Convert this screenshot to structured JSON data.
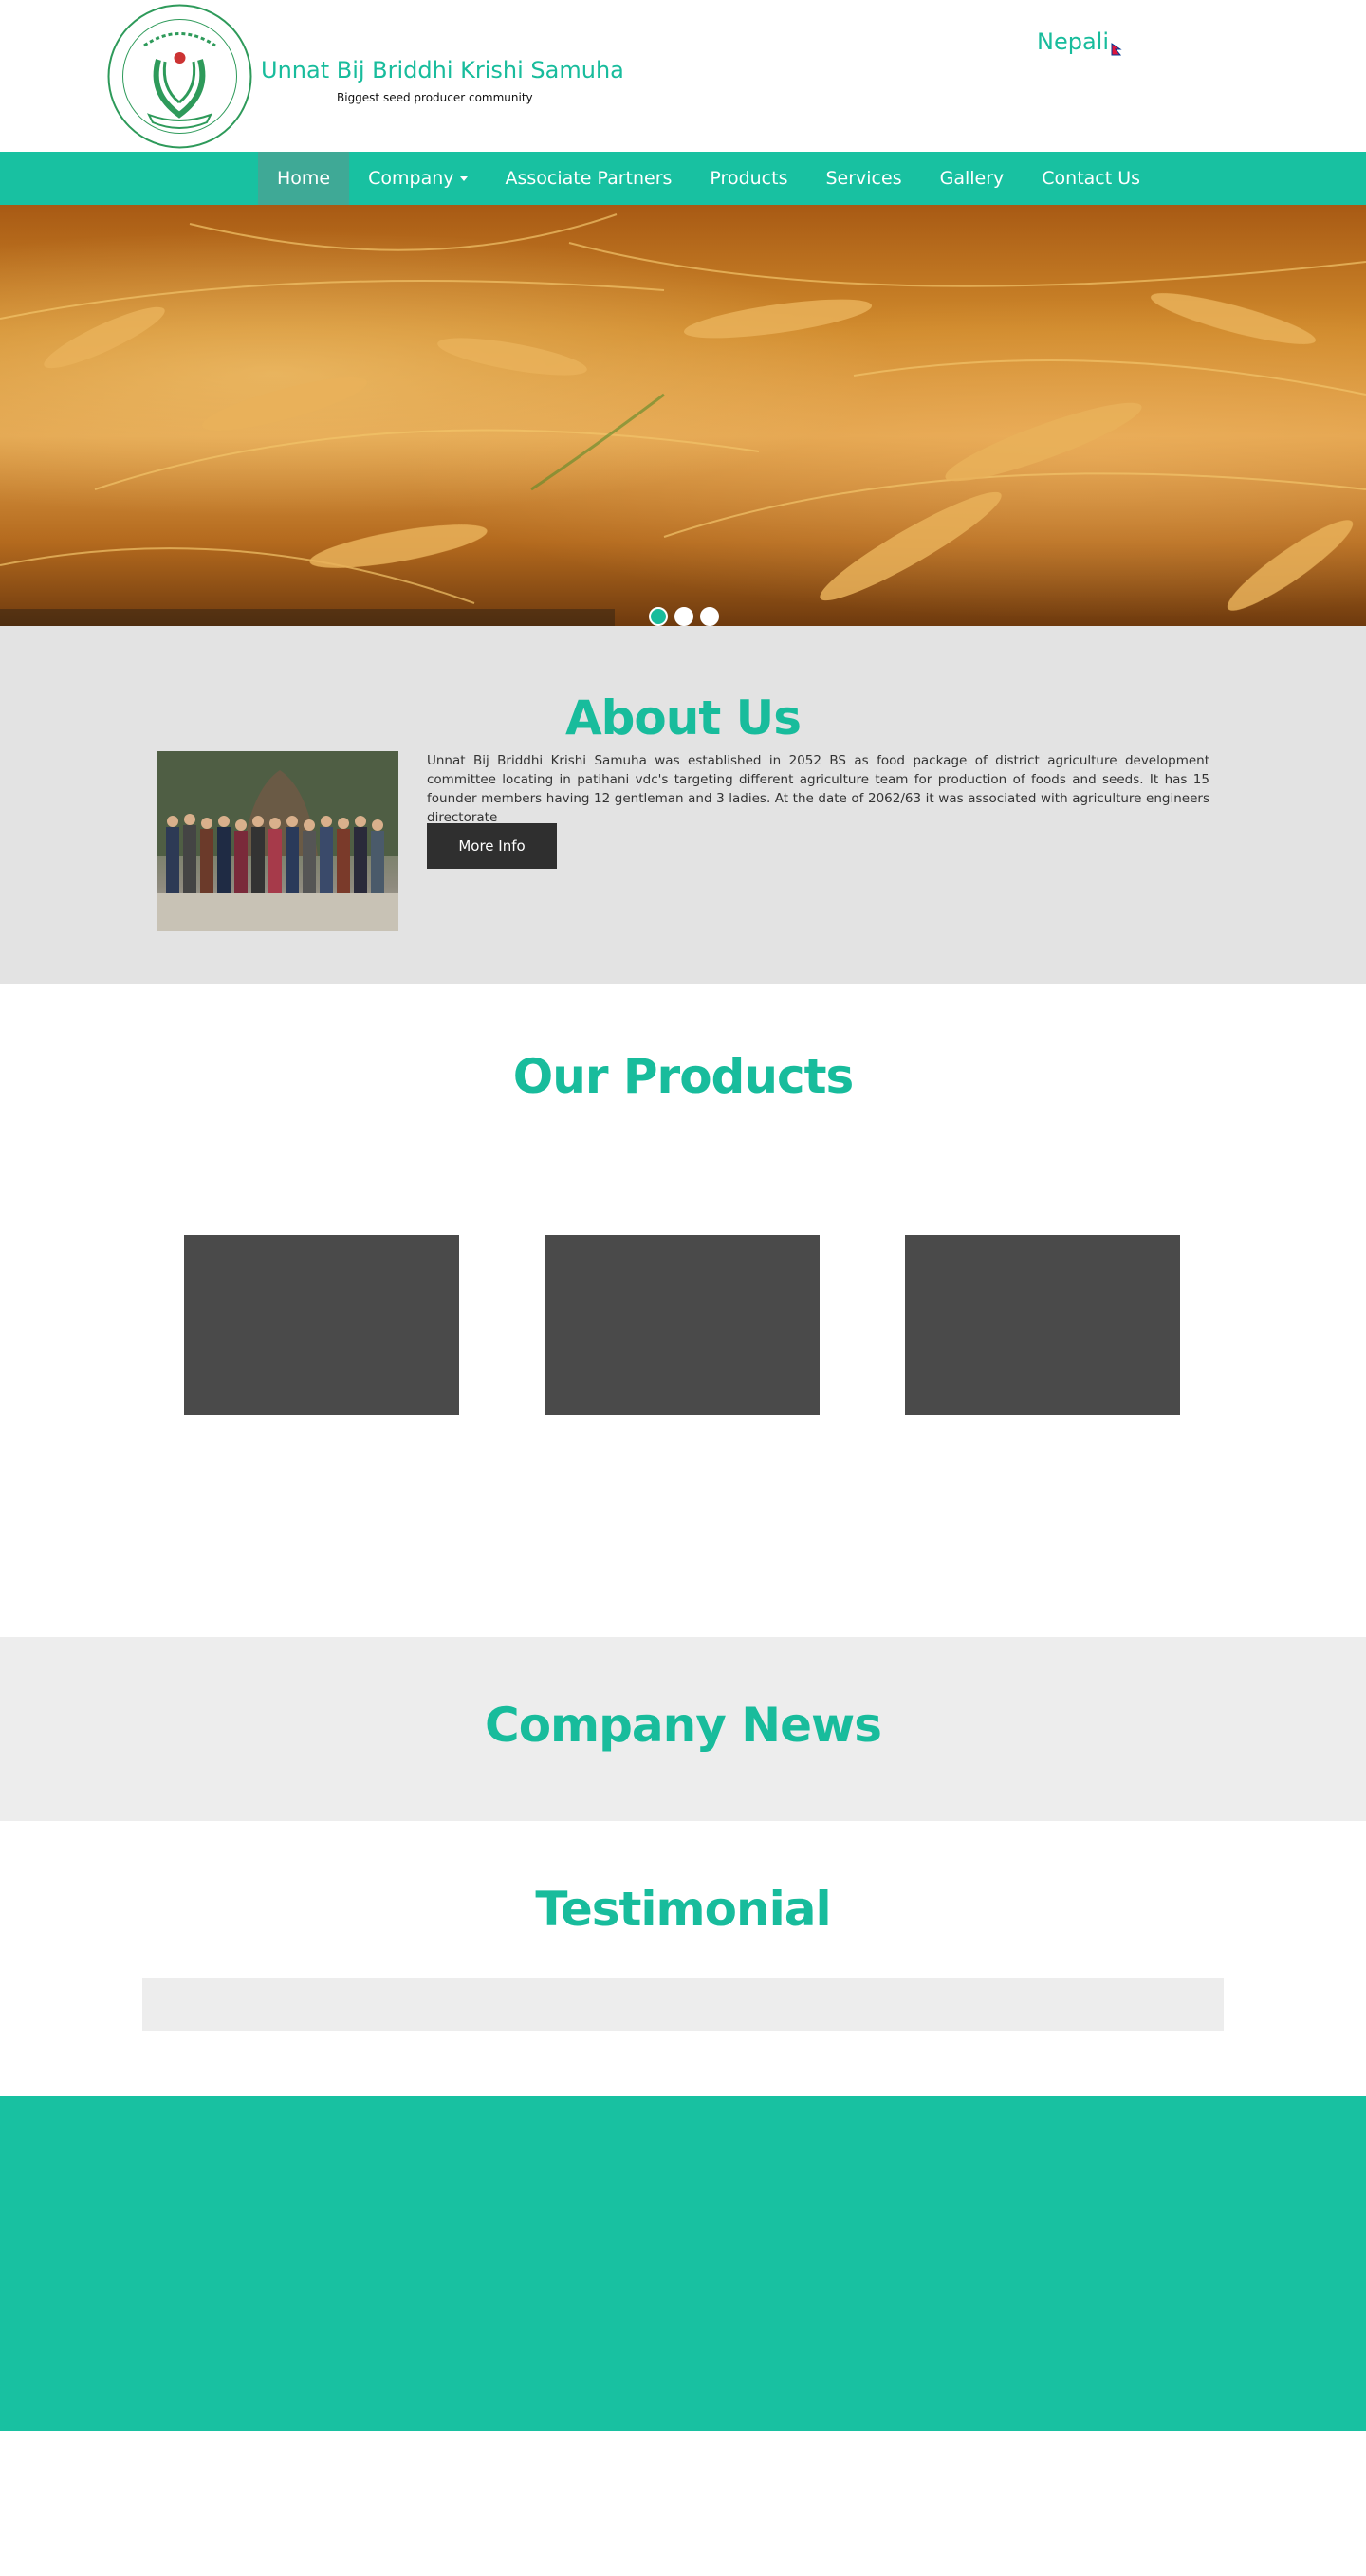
{
  "header": {
    "logo_icon": "organization-seal-logo",
    "site_title": "Unnat Bij Briddhi Krishi Samuha",
    "tagline": "Biggest seed producer community",
    "language_switch": "Nepali",
    "flag_icon": "nepal-flag-icon"
  },
  "nav": {
    "items": [
      {
        "label": "Home",
        "active": true
      },
      {
        "label": "Company",
        "dropdown": true
      },
      {
        "label": "Associate Partners"
      },
      {
        "label": "Products"
      },
      {
        "label": "Services"
      },
      {
        "label": "Gallery"
      },
      {
        "label": "Contact Us"
      }
    ]
  },
  "hero": {
    "image": "wheat field banner",
    "slides": 3,
    "active_slide": 1
  },
  "about": {
    "title": "About Us",
    "image": "group photo of members under a large tree",
    "text": "Unnat Bij Briddhi Krishi Samuha was established in 2052 BS as food package of district agriculture development committee locating in patihani vdc's targeting different agriculture team for production of foods and seeds. It has 15 founder members having 12 gentleman and 3 ladies. At the date of 2062/63 it was associated with agriculture engineers directorate",
    "button": "More Info"
  },
  "products": {
    "title": "Our Products",
    "items": 3
  },
  "news": {
    "title": "Company News"
  },
  "testimonial": {
    "title": "Testimonial"
  },
  "colors": {
    "accent": "#18bc9c",
    "nav_bg": "#18c1a1",
    "nav_active": "#3fa996",
    "button_bg": "#2f2f2f",
    "product_placeholder": "#4a4a4a"
  }
}
